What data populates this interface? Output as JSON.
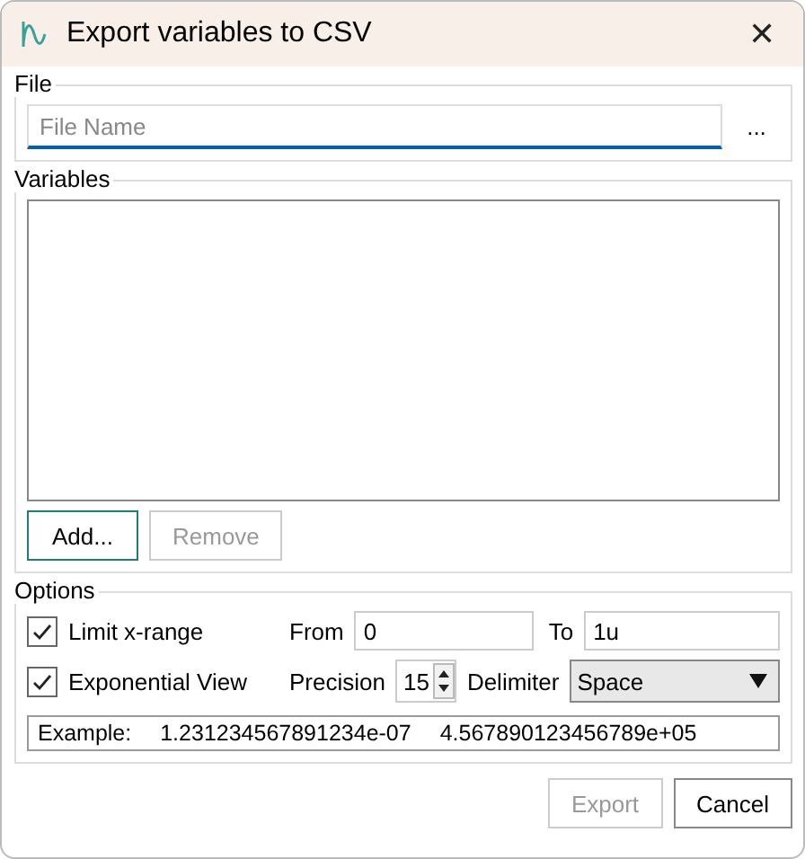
{
  "window": {
    "title": "Export variables to CSV",
    "close": "✕"
  },
  "file": {
    "label": "File",
    "placeholder": "File Name",
    "browse": "..."
  },
  "variables": {
    "label": "Variables",
    "buttons": [
      {
        "label": "Add...",
        "disabled": false,
        "focused": true
      },
      {
        "label": "Remove",
        "disabled": true,
        "focused": false
      }
    ]
  },
  "options": {
    "label": "Options",
    "checkboxes": [
      {
        "label": "Limit x-range",
        "checked": true
      },
      {
        "label": "Exponential View",
        "checked": true
      }
    ],
    "from": {
      "label": "From",
      "value": "0"
    },
    "to": {
      "label": "To",
      "value": "1u"
    },
    "precision": {
      "label": "Precision",
      "value": "15"
    },
    "delimiter": {
      "label": "Delimiter",
      "value": "Space"
    },
    "example": {
      "label": "Example:",
      "values": [
        "1.231234567891234e-07",
        "4.567890123456789e+05"
      ]
    }
  },
  "buttons": [
    {
      "label": "Export",
      "disabled": true
    },
    {
      "label": "Cancel",
      "disabled": false
    }
  ]
}
